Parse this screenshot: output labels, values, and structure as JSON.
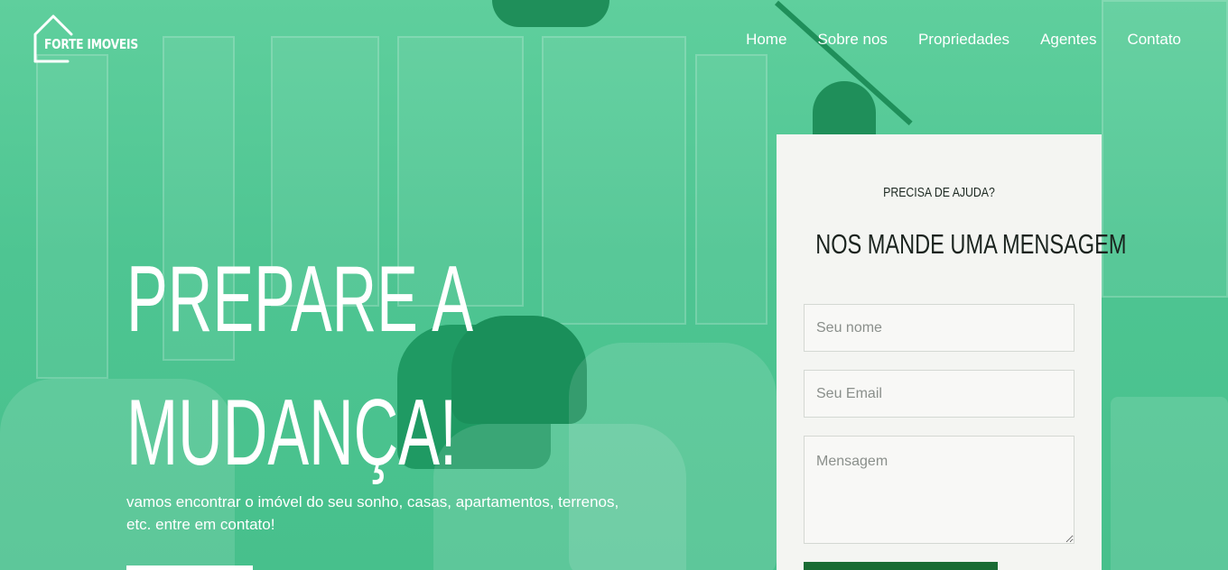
{
  "brand": {
    "name": "FORTE IMOVEIS",
    "icon": "house-outline-icon"
  },
  "nav": {
    "items": [
      {
        "label": "Home"
      },
      {
        "label": "Sobre nos"
      },
      {
        "label": "Propriedades"
      },
      {
        "label": "Agentes"
      },
      {
        "label": "Contato"
      }
    ]
  },
  "hero": {
    "headline_line1": "PREPARE A",
    "headline_line2": "MUDANÇA!",
    "tagline": "vamos encontrar o imóvel do seu sonho, casas, apartamentos, terrenos, etc. entre em contato!"
  },
  "contact": {
    "kicker": "PRECISA DE AJUDA?",
    "title": "NOS MANDE UMA MENSAGEM",
    "name_placeholder": "Seu nome",
    "email_placeholder": "Seu Email",
    "message_placeholder": "Mensagem"
  },
  "colors": {
    "overlay": "#4cc590",
    "card": "#f4f5f2",
    "submit": "#1a6b34",
    "text_light": "#ffffff"
  }
}
